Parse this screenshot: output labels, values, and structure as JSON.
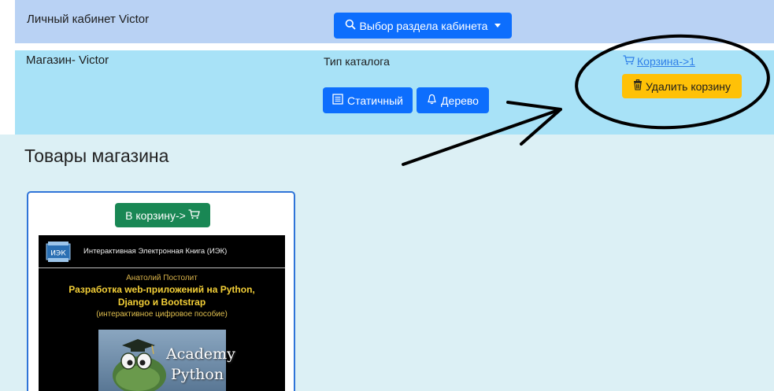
{
  "topbar": {
    "title": "Личный кабинет Victor",
    "section_button": "Выбор раздела кабинета"
  },
  "shopbar": {
    "title": "Магазин- Victor",
    "catalog_label": "Тип каталога",
    "static_button": "Статичный",
    "tree_button": "Дерево",
    "cart_link": "Корзина->1",
    "delete_button": "Удалить корзину"
  },
  "main": {
    "heading": "Товары магазина",
    "card": {
      "add_button": "В корзину->",
      "book": {
        "logo": "ИЭК",
        "series": "Интерактивная Электронная Книга (ИЭК)",
        "author": "Анатолий Постолит",
        "title_line1": "Разработка web-приложений на Python,",
        "title_line2": "Django и Bootstrap",
        "subtitle": "(интерактивное цифровое пособие)",
        "cover_line1": "Academy",
        "cover_line2": "Python"
      }
    }
  },
  "colors": {
    "primary": "#0d6efd",
    "warning": "#ffc107",
    "success": "#198754",
    "topbar_bg": "#b9d2f4",
    "shopbar_bg": "#a8e2f7",
    "main_bg": "#dcf0f5"
  }
}
